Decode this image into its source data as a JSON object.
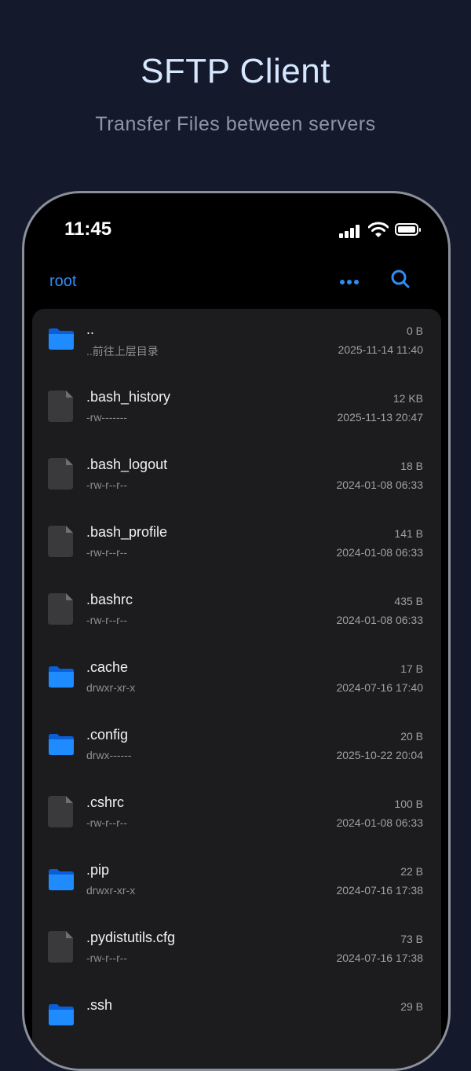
{
  "hero": {
    "title": "SFTP Client",
    "subtitle": "Transfer Files between servers"
  },
  "status_bar": {
    "time": "11:45"
  },
  "nav": {
    "title": "root",
    "more_icon": "ellipsis-icon",
    "search_icon": "search-icon"
  },
  "colors": {
    "accent": "#2f8df5",
    "background": "#141a2b",
    "list_bg": "#1c1c1e"
  },
  "files": [
    {
      "name": "..",
      "sub": "..前往上层目录",
      "size": "0 B",
      "date": "2025-11-14 11:40",
      "type": "folder"
    },
    {
      "name": ".bash_history",
      "sub": "-rw-------",
      "size": "12 KB",
      "date": "2025-11-13 20:47",
      "type": "file"
    },
    {
      "name": ".bash_logout",
      "sub": "-rw-r--r--",
      "size": "18 B",
      "date": "2024-01-08 06:33",
      "type": "file"
    },
    {
      "name": ".bash_profile",
      "sub": "-rw-r--r--",
      "size": "141 B",
      "date": "2024-01-08 06:33",
      "type": "file"
    },
    {
      "name": ".bashrc",
      "sub": "-rw-r--r--",
      "size": "435 B",
      "date": "2024-01-08 06:33",
      "type": "file"
    },
    {
      "name": ".cache",
      "sub": "drwxr-xr-x",
      "size": "17 B",
      "date": "2024-07-16 17:40",
      "type": "folder"
    },
    {
      "name": ".config",
      "sub": "drwx------",
      "size": "20 B",
      "date": "2025-10-22 20:04",
      "type": "folder"
    },
    {
      "name": ".cshrc",
      "sub": "-rw-r--r--",
      "size": "100 B",
      "date": "2024-01-08 06:33",
      "type": "file"
    },
    {
      "name": ".pip",
      "sub": "drwxr-xr-x",
      "size": "22 B",
      "date": "2024-07-16 17:38",
      "type": "folder"
    },
    {
      "name": ".pydistutils.cfg",
      "sub": "-rw-r--r--",
      "size": "73 B",
      "date": "2024-07-16 17:38",
      "type": "file"
    },
    {
      "name": ".ssh",
      "sub": "",
      "size": "29 B",
      "date": "",
      "type": "folder"
    }
  ]
}
